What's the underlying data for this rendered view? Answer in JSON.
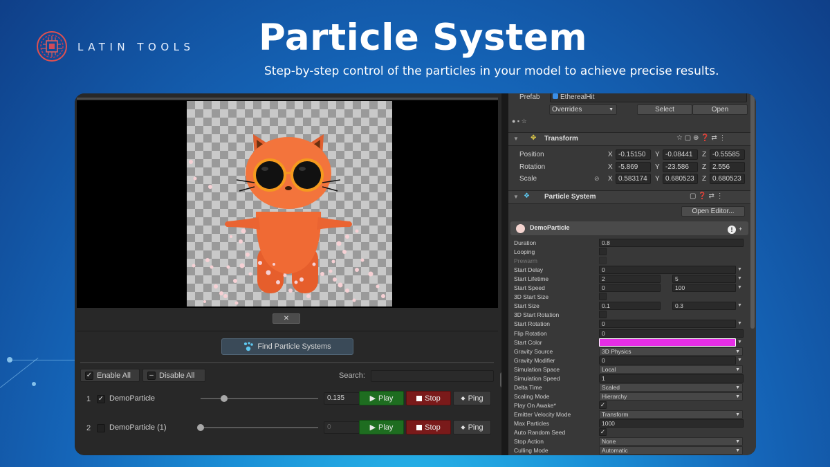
{
  "brand": {
    "name": "LATIN TOOLS"
  },
  "hero": {
    "title": "Particle System",
    "subtitle": "Step-by-step control of the particles in your model to achieve precise results."
  },
  "emitter_panel": {
    "close_glyph": "✕",
    "find_button": "Find Particle Systems",
    "enable_all": "Enable All",
    "disable_all": "Disable All",
    "search_label": "Search:",
    "rows": [
      {
        "index": "1",
        "checked": true,
        "name": "DemoParticle",
        "slider": 0.2,
        "value": "0.135",
        "play": "Play",
        "stop": "Stop",
        "ping": "Ping"
      },
      {
        "index": "2",
        "checked": false,
        "name": "DemoParticle (1)",
        "slider": 0.0,
        "value": "0",
        "play": "Play",
        "stop": "Stop",
        "ping": "Ping"
      }
    ]
  },
  "inspector": {
    "prefab_label": "Prefab",
    "prefab_value": "EtherealHit",
    "overrides": "Overrides",
    "select": "Select",
    "open": "Open",
    "transform": {
      "title": "Transform",
      "position_label": "Position",
      "rotation_label": "Rotation",
      "scale_label": "Scale",
      "axis_x": "X",
      "axis_y": "Y",
      "axis_z": "Z",
      "position": [
        "-0.15150",
        "-0.08441",
        "-0.55585"
      ],
      "rotation": [
        "-5.869",
        "-23.586",
        "2.556"
      ],
      "scale": [
        "0.583174",
        "0.680523",
        "0.680523"
      ]
    },
    "particle_system": {
      "title": "Particle System",
      "open_editor": "Open Editor...",
      "module_name": "DemoParticle",
      "start_color": "#e62ee6",
      "props": [
        {
          "label": "Duration",
          "type": "field",
          "value": "0.8"
        },
        {
          "label": "Looping",
          "type": "check",
          "checked": false
        },
        {
          "label": "Prewarm",
          "type": "check",
          "checked": false,
          "disabled": true
        },
        {
          "label": "Start Delay",
          "type": "field",
          "value": "0",
          "arrow": true
        },
        {
          "label": "Start Lifetime",
          "type": "range",
          "value": "2",
          "value2": "5",
          "arrow": true
        },
        {
          "label": "Start Speed",
          "type": "range",
          "value": "0",
          "value2": "100",
          "arrow": true
        },
        {
          "label": "3D Start Size",
          "type": "check",
          "checked": false
        },
        {
          "label": "Start Size",
          "type": "range",
          "value": "0.1",
          "value2": "0.3",
          "arrow": true
        },
        {
          "label": "3D Start Rotation",
          "type": "check",
          "checked": false
        },
        {
          "label": "Start Rotation",
          "type": "field",
          "value": "0",
          "arrow": true
        },
        {
          "label": "Flip Rotation",
          "type": "field",
          "value": "0"
        },
        {
          "label": "Start Color",
          "type": "color",
          "arrow": true
        },
        {
          "label": "Gravity Source",
          "type": "dropdown",
          "value": "3D Physics"
        },
        {
          "label": "Gravity Modifier",
          "type": "field",
          "value": "0",
          "arrow": true
        },
        {
          "label": "Simulation Space",
          "type": "dropdown",
          "value": "Local"
        },
        {
          "label": "Simulation Speed",
          "type": "field",
          "value": "1"
        },
        {
          "label": "Delta Time",
          "type": "dropdown",
          "value": "Scaled"
        },
        {
          "label": "Scaling Mode",
          "type": "dropdown",
          "value": "Hierarchy"
        },
        {
          "label": "Play On Awake*",
          "type": "check",
          "checked": true
        },
        {
          "label": "Emitter Velocity Mode",
          "type": "dropdown",
          "value": "Transform"
        },
        {
          "label": "Max Particles",
          "type": "field",
          "value": "1000"
        },
        {
          "label": "Auto Random Seed",
          "type": "check",
          "checked": true
        },
        {
          "label": "Stop Action",
          "type": "dropdown",
          "value": "None"
        },
        {
          "label": "Culling Mode",
          "type": "dropdown",
          "value": "Automatic"
        }
      ]
    }
  }
}
